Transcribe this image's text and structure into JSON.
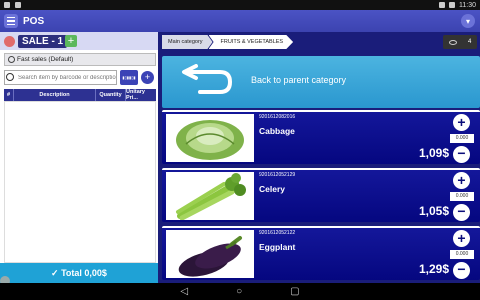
{
  "status": {
    "time": "11:30"
  },
  "app": {
    "title": "POS"
  },
  "sale": {
    "title": "SALE - 1",
    "add": "+"
  },
  "fast_sales": {
    "label": "Fast sales (Default)"
  },
  "search": {
    "placeholder": "Search item by barcode or description",
    "plus": "+"
  },
  "table": {
    "headers": [
      "#",
      "Description",
      "Quantity",
      "Unitary Pri..."
    ]
  },
  "total": {
    "label": "✓ Total  0,00$"
  },
  "breadcrumbs": [
    "Main category",
    "FRUITS & VEGETABLES"
  ],
  "view_count": "4",
  "back": {
    "label": "Back to parent category"
  },
  "products": [
    {
      "sku": "9201612082016",
      "name": "Cabbage",
      "price": "1,09$",
      "qty": "0.000"
    },
    {
      "sku": "9201612052129",
      "name": "Celery",
      "price": "1,05$",
      "qty": "0.000"
    },
    {
      "sku": "9201612052122",
      "name": "Eggplant",
      "price": "1,29$",
      "qty": "0.000"
    }
  ],
  "colors": {
    "appbar": "#4b53c4",
    "product_bg": "#0b0d84",
    "total_bar": "#1fa2d6",
    "back_card": "#3aa7da"
  }
}
